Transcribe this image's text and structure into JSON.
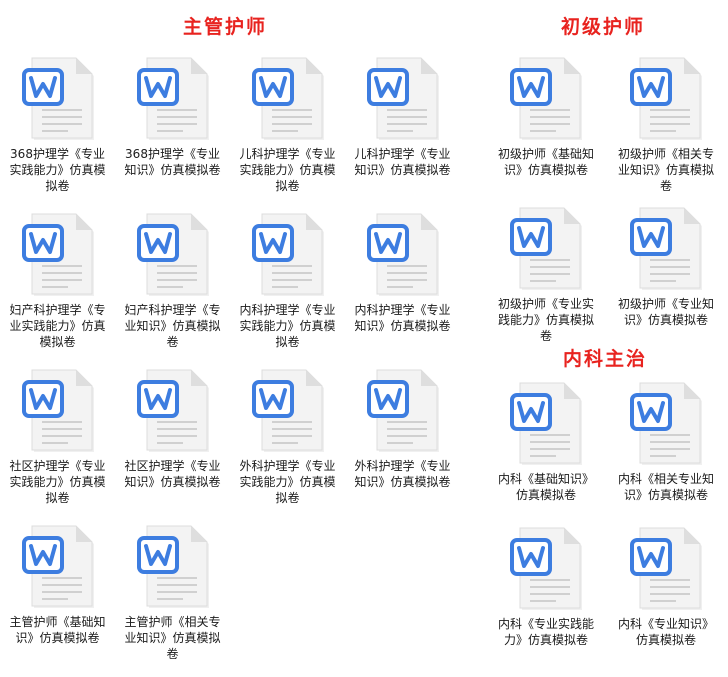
{
  "sections": {
    "zhuguan": {
      "title": "主管护师",
      "files": [
        {
          "label": "368护理学《专业实践能力》仿真模拟卷"
        },
        {
          "label": "368护理学《专业知识》仿真模拟卷"
        },
        {
          "label": "儿科护理学《专业实践能力》仿真模拟卷"
        },
        {
          "label": "儿科护理学《专业知识》仿真模拟卷"
        },
        {
          "label": "妇产科护理学《专业实践能力》仿真模拟卷"
        },
        {
          "label": "妇产科护理学《专业知识》仿真模拟卷"
        },
        {
          "label": "内科护理学《专业实践能力》仿真模拟卷"
        },
        {
          "label": "内科护理学《专业知识》仿真模拟卷"
        },
        {
          "label": "社区护理学《专业实践能力》仿真模拟卷"
        },
        {
          "label": "社区护理学《专业知识》仿真模拟卷"
        },
        {
          "label": "外科护理学《专业实践能力》仿真模拟卷"
        },
        {
          "label": "外科护理学《专业知识》仿真模拟卷"
        },
        {
          "label": "主管护师《基础知识》仿真模拟卷"
        },
        {
          "label": "主管护师《相关专业知识》仿真模拟卷"
        }
      ]
    },
    "chuji": {
      "title": "初级护师",
      "files": [
        {
          "label": "初级护师《基础知识》仿真模拟卷"
        },
        {
          "label": "初级护师《相关专业知识》仿真模拟卷"
        },
        {
          "label": "初级护师《专业实践能力》仿真模拟卷"
        },
        {
          "label": "初级护师《专业知识》仿真模拟卷"
        }
      ]
    },
    "neike": {
      "title": "内科主治",
      "files": [
        {
          "label": "内科《基础知识》仿真模拟卷"
        },
        {
          "label": "内科《相关专业知识》仿真模拟卷"
        },
        {
          "label": "内科《专业实践能力》仿真模拟卷"
        },
        {
          "label": "内科《专业知识》仿真模拟卷"
        }
      ]
    }
  },
  "icon": {
    "type": "word-document-icon",
    "glyph": "W",
    "accent": "#3d7de0",
    "sheet": "#f3f3f3",
    "lines": "#d0d0d0"
  },
  "colors": {
    "title": "#e8231f",
    "text": "#1b1b1b",
    "background": "#ffffff"
  }
}
